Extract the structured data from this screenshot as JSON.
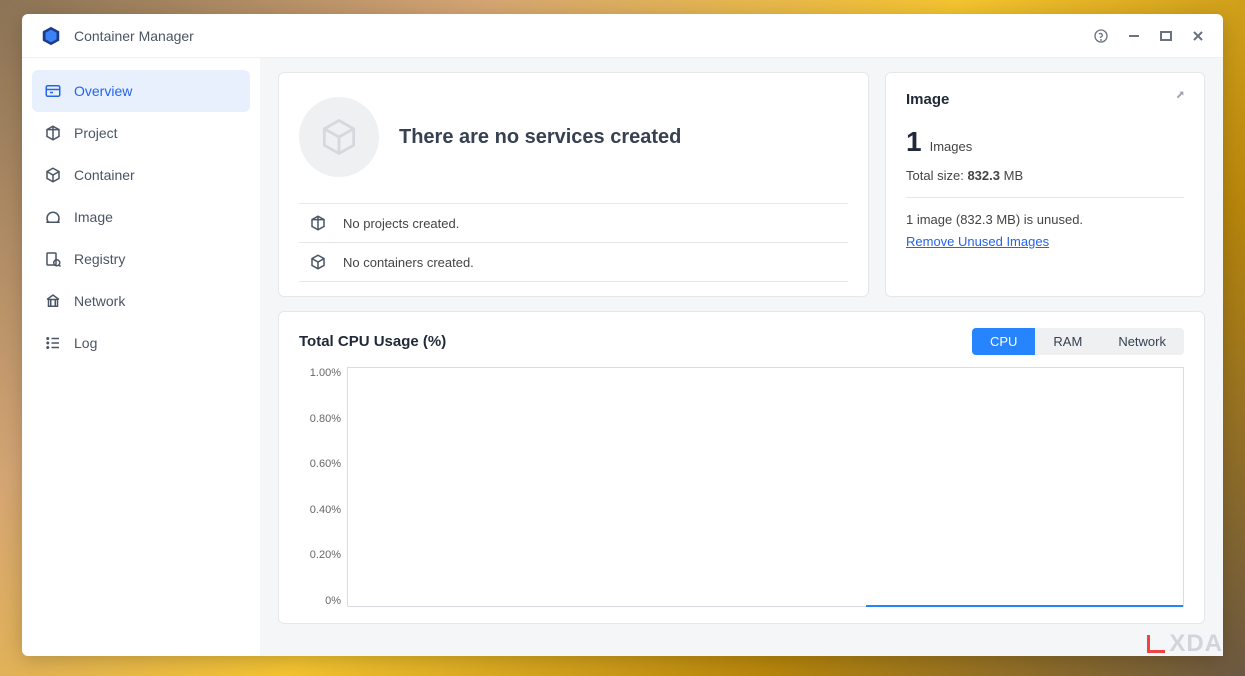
{
  "app": {
    "title": "Container Manager"
  },
  "sidebar": {
    "items": [
      {
        "label": "Overview",
        "icon": "overview"
      },
      {
        "label": "Project",
        "icon": "project"
      },
      {
        "label": "Container",
        "icon": "container"
      },
      {
        "label": "Image",
        "icon": "image"
      },
      {
        "label": "Registry",
        "icon": "registry"
      },
      {
        "label": "Network",
        "icon": "network"
      },
      {
        "label": "Log",
        "icon": "log"
      }
    ]
  },
  "services": {
    "title": "There are no services created",
    "rows": [
      "No projects created.",
      "No containers created."
    ]
  },
  "image_panel": {
    "title": "Image",
    "count": "1",
    "count_label": "Images",
    "size_label": "Total size:",
    "size_value": "832.3",
    "size_unit": "MB",
    "unused_text": "1 image (832.3 MB) is unused.",
    "remove_link": "Remove Unused Images"
  },
  "cpu": {
    "title": "Total CPU Usage (%)",
    "tabs": {
      "cpu": "CPU",
      "ram": "RAM",
      "network": "Network"
    }
  },
  "chart_data": {
    "type": "line",
    "title": "Total CPU Usage (%)",
    "xlabel": "",
    "ylabel": "",
    "ylim": [
      0,
      1.0
    ],
    "y_ticks": [
      "1.00%",
      "0.80%",
      "0.60%",
      "0.40%",
      "0.20%",
      "0%"
    ],
    "series": [
      {
        "name": "CPU",
        "values": [
          0,
          0,
          0,
          0,
          0,
          0,
          0,
          0,
          0,
          0
        ]
      }
    ],
    "note": "Flat line at 0%; data only visible on right portion of timeline"
  },
  "watermark": "XDA"
}
